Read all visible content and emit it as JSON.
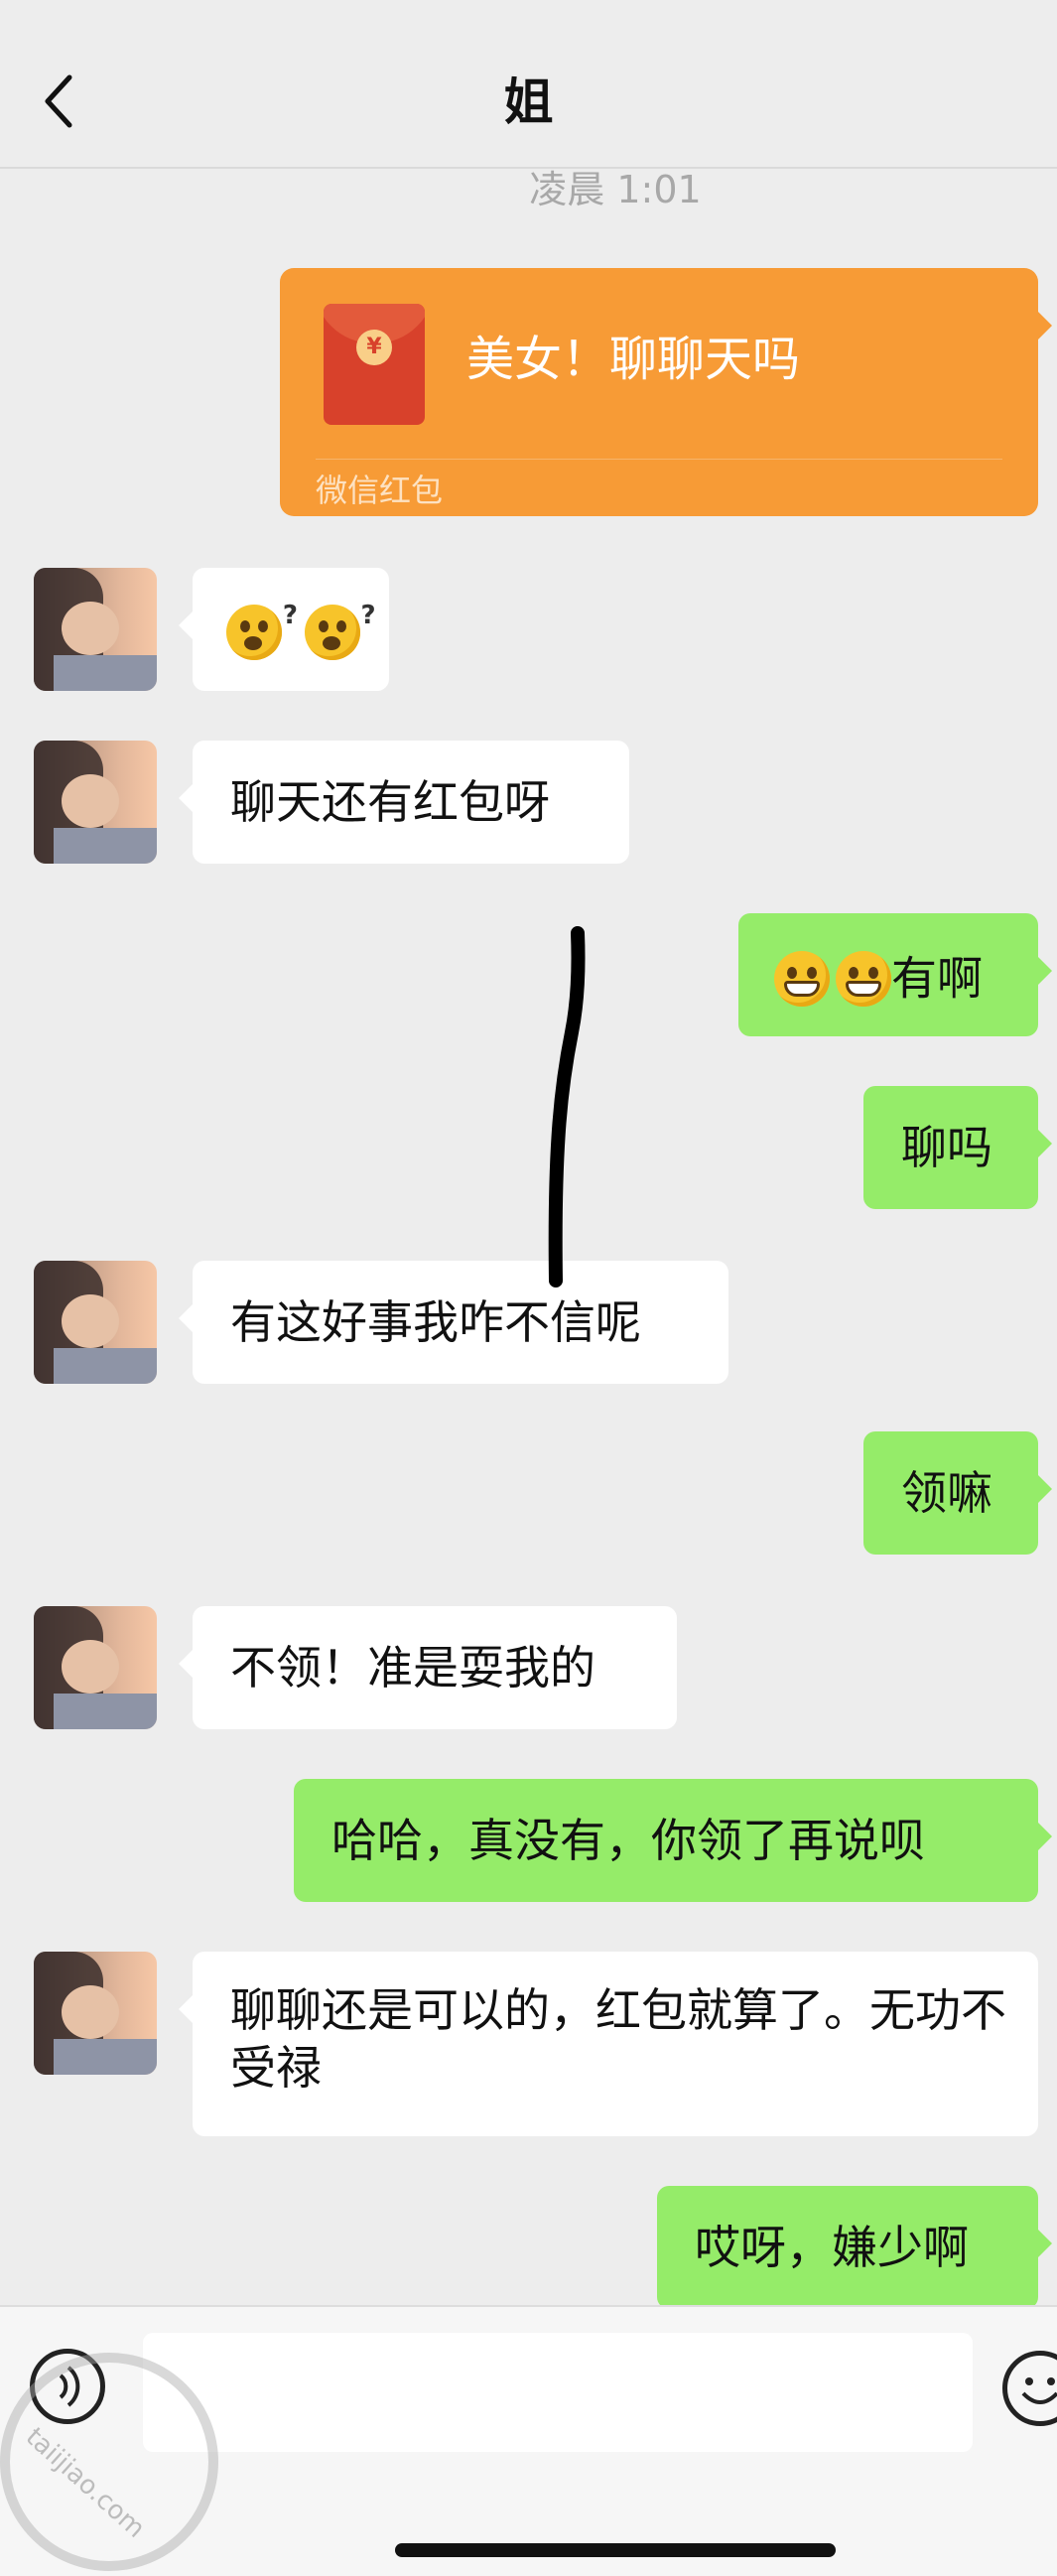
{
  "header": {
    "title": "姐",
    "back_icon": "chevron-left-icon"
  },
  "timestamp": "凌晨 1:01",
  "red_packet": {
    "message": "美女！聊聊天吗",
    "label": "微信红包",
    "icon": "red-envelope-icon"
  },
  "messages": [
    {
      "side": "in",
      "type": "emoji",
      "icons": [
        "puzzled-face-icon",
        "puzzled-face-icon"
      ]
    },
    {
      "side": "in",
      "text": "聊天还有红包呀"
    },
    {
      "side": "out",
      "text": "有啊",
      "emoji": [
        "grin-face-icon",
        "grin-face-icon"
      ]
    },
    {
      "side": "out",
      "text": "聊吗"
    },
    {
      "side": "in",
      "text": "有这好事我咋不信呢"
    },
    {
      "side": "out",
      "text": "领嘛"
    },
    {
      "side": "in",
      "text": "不领！准是耍我的"
    },
    {
      "side": "out",
      "text": "哈哈，真没有，你领了再说呗"
    },
    {
      "side": "in",
      "text": "聊聊还是可以的，红包就算了。无功不受禄"
    },
    {
      "side": "out",
      "text": "哎呀，嫌少啊"
    }
  ],
  "input_bar": {
    "voice_icon": "voice-icon",
    "emoji_icon": "smiley-icon",
    "value": ""
  },
  "watermark": "taiijiao.com",
  "colors": {
    "outgoing": "#95ec69",
    "incoming": "#ffffff",
    "packet": "#f79b36",
    "background": "#ededed"
  }
}
